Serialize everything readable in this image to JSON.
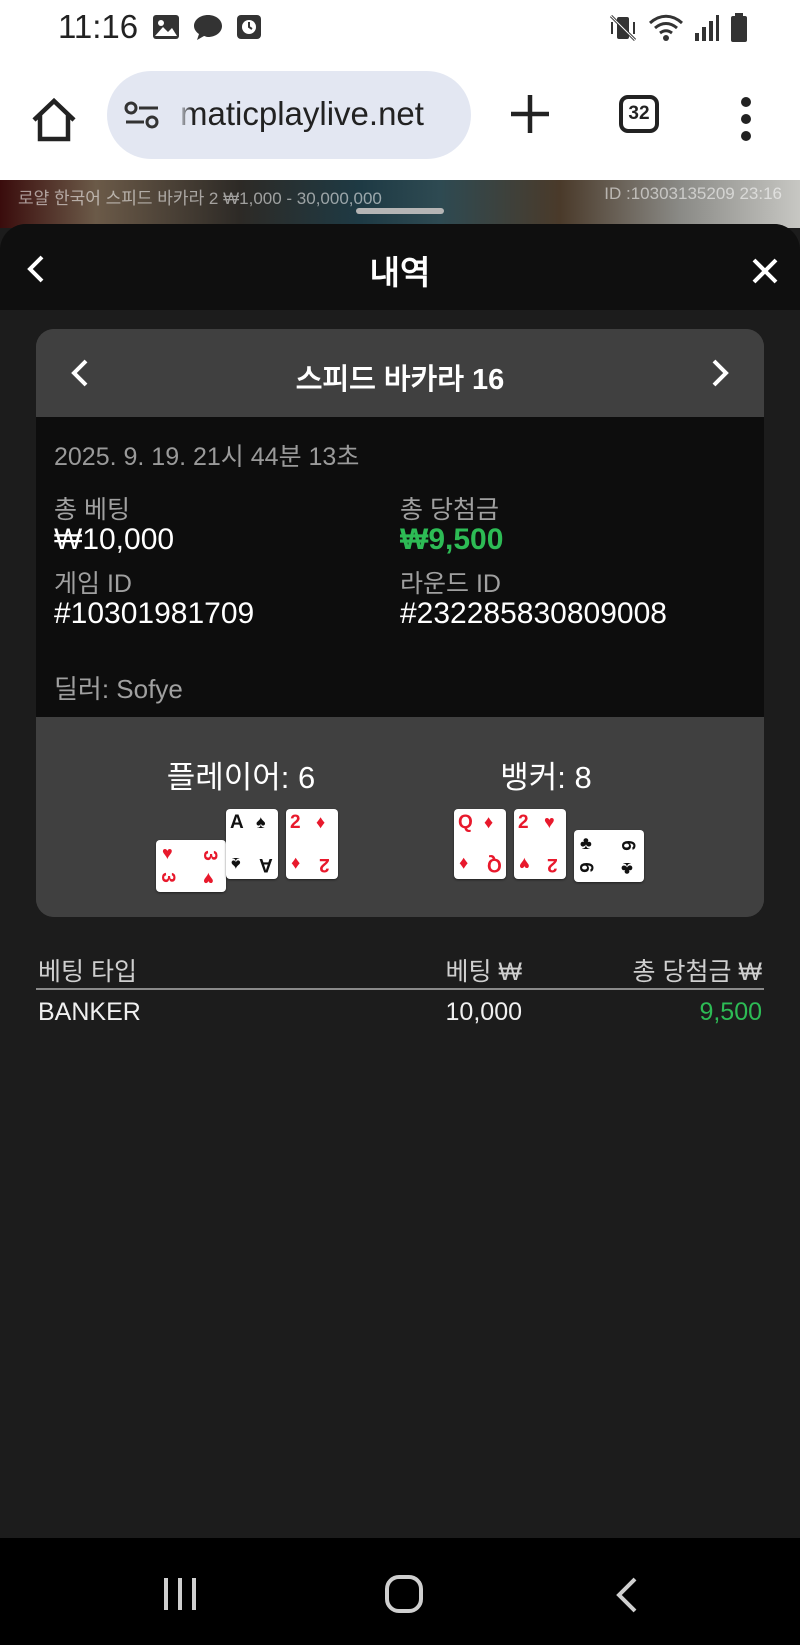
{
  "status_bar": {
    "time": "11:16"
  },
  "browser": {
    "url": "maticplaylive.net",
    "tab_count": "32"
  },
  "game_strip": {
    "title": "로얄 한국어 스피드 바카라 2 ₩1,000 - 30,000,000",
    "id_text": "ID :10303135209 23:16"
  },
  "sheet": {
    "title": "내역",
    "card": {
      "game_name": "스피드 바카라 16",
      "datetime": "2025. 9. 19. 21시 44분 13초",
      "total_bet_label": "총 베팅",
      "total_bet_value": "₩10,000",
      "total_win_label": "총 당첨금",
      "total_win_value": "₩9,500",
      "game_id_label": "게임 ID",
      "game_id_value": "#10301981709",
      "round_id_label": "라운드 ID",
      "round_id_value": "#232285830809008",
      "dealer": "딜러: Sofye",
      "player_label": "플레이어: 6",
      "banker_label": "뱅커: 8",
      "player_cards": [
        {
          "rank": "3",
          "suit": "♥"
        },
        {
          "rank": "A",
          "suit": "♠"
        },
        {
          "rank": "2",
          "suit": "♦"
        }
      ],
      "banker_cards": [
        {
          "rank": "Q",
          "suit": "♦"
        },
        {
          "rank": "2",
          "suit": "♥"
        },
        {
          "rank": "6",
          "suit": "♣"
        }
      ]
    },
    "bets": {
      "headers": {
        "type": "베팅 타입",
        "bet": "베팅 ₩",
        "win": "총 당첨금 ₩"
      },
      "rows": [
        {
          "type": "BANKER",
          "bet": "10,000",
          "win": "9,500"
        }
      ]
    }
  },
  "colors": {
    "win_green": "#2dbb55",
    "card_red": "#e8192c",
    "sheet_bg": "#1c1c1c",
    "card_bg": "#404040"
  }
}
